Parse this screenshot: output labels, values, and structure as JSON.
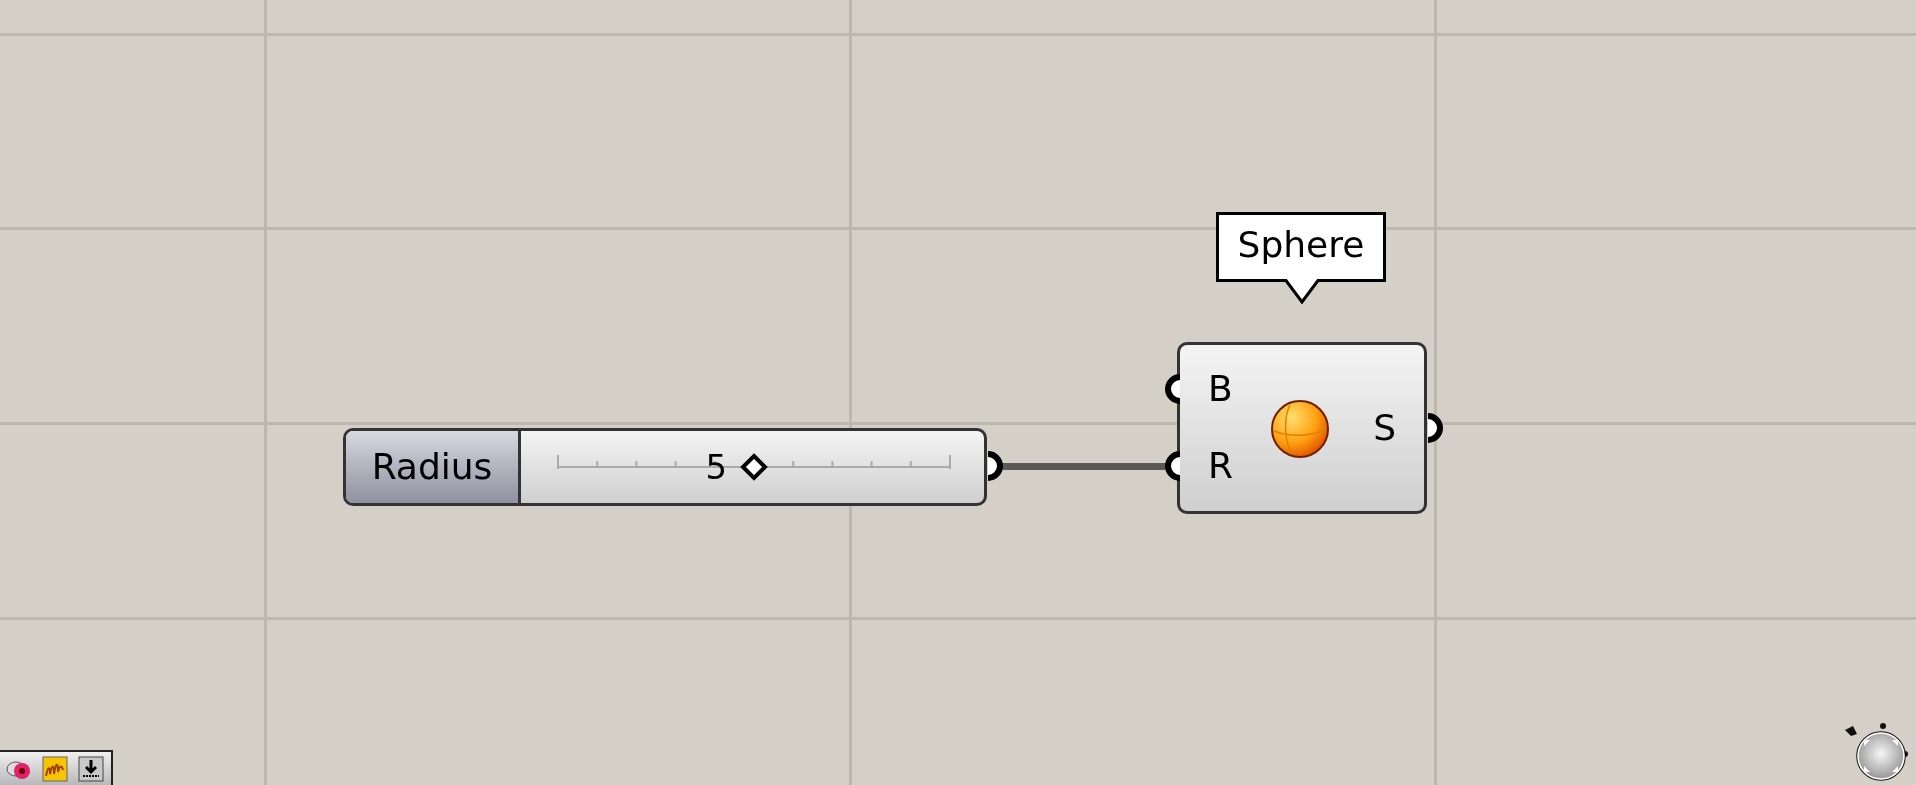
{
  "slider": {
    "label": "Radius",
    "value": "5",
    "level": 0.5
  },
  "component": {
    "tooltip": "Sphere",
    "inputs": [
      "B",
      "R"
    ],
    "outputs": [
      "S"
    ]
  }
}
